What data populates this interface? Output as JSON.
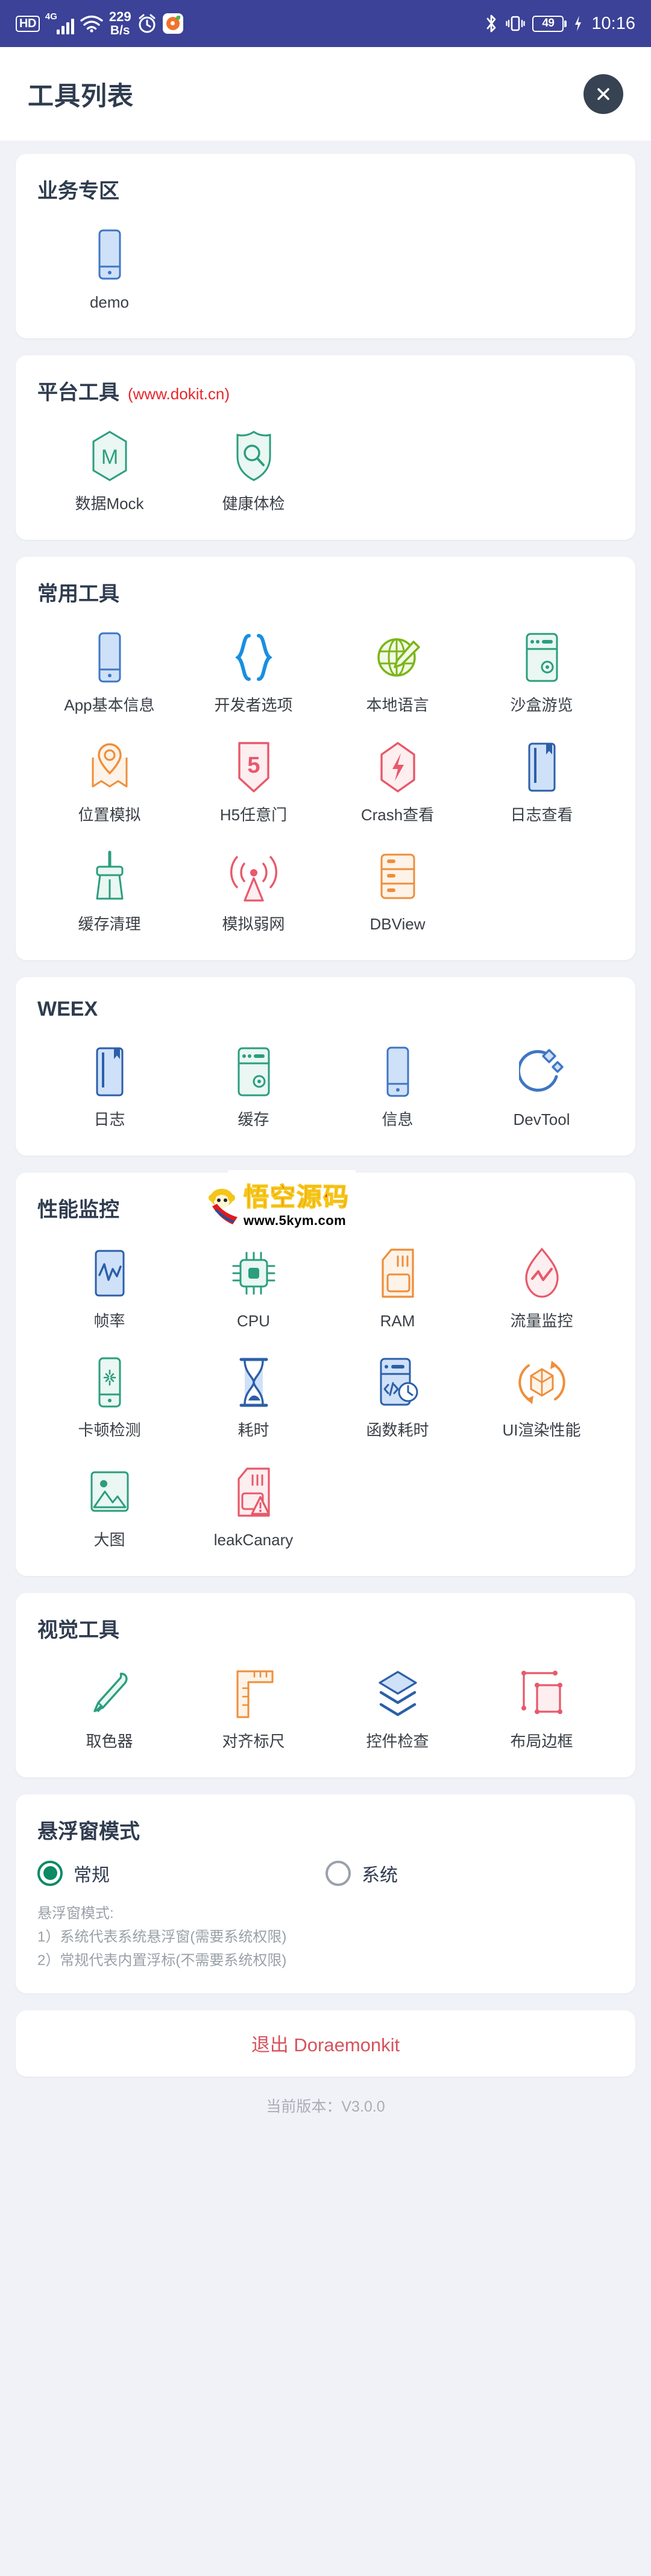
{
  "statusbar": {
    "hd": "HD",
    "network": "4G",
    "speed_value": "229",
    "speed_unit": "B/s",
    "battery": "49",
    "time": "10:16",
    "icons": [
      "hd-icon",
      "signal-4g-icon",
      "wifi-icon",
      "network-speed",
      "alarm-clock-icon",
      "app-badge-icon",
      "bluetooth-icon",
      "vibrate-icon",
      "battery-icon",
      "charging-icon"
    ]
  },
  "appbar": {
    "title": "工具列表",
    "close_label": "×"
  },
  "sections": [
    {
      "id": "business",
      "title": "业务专区",
      "subtitle": "",
      "items": [
        {
          "label": "demo",
          "icon": "phone-icon",
          "color": "#3f76c4"
        }
      ]
    },
    {
      "id": "platform",
      "title": "平台工具",
      "subtitle": "(www.dokit.cn)",
      "items": [
        {
          "label": "数据Mock",
          "icon": "mock-hexagon-icon",
          "color": "#2b9e7e"
        },
        {
          "label": "健康体检",
          "icon": "shield-search-icon",
          "color": "#2b9e7e"
        }
      ]
    },
    {
      "id": "common",
      "title": "常用工具",
      "subtitle": "",
      "items": [
        {
          "label": "App基本信息",
          "icon": "phone-icon",
          "color": "#3f76c4"
        },
        {
          "label": "开发者选项",
          "icon": "braces-icon",
          "color": "#1a8fe0"
        },
        {
          "label": "本地语言",
          "icon": "globe-pen-icon",
          "color": "#7cb518"
        },
        {
          "label": "沙盒游览",
          "icon": "server-icon",
          "color": "#2b9e7e"
        },
        {
          "label": "位置模拟",
          "icon": "map-pin-icon",
          "color": "#ef8e3a"
        },
        {
          "label": "H5任意门",
          "icon": "html5-icon",
          "color": "#e8596a"
        },
        {
          "label": "Crash查看",
          "icon": "crash-bolt-icon",
          "color": "#e8596a"
        },
        {
          "label": "日志查看",
          "icon": "log-book-icon",
          "color": "#3f76c4"
        },
        {
          "label": "缓存清理",
          "icon": "broom-icon",
          "color": "#2b9e7e"
        },
        {
          "label": "模拟弱网",
          "icon": "signal-tower-icon",
          "color": "#e8596a"
        },
        {
          "label": "DBView",
          "icon": "database-icon",
          "color": "#ef8e3a"
        }
      ]
    },
    {
      "id": "weex",
      "title": "WEEX",
      "subtitle": "",
      "items": [
        {
          "label": "日志",
          "icon": "log-book-icon",
          "color": "#3f76c4"
        },
        {
          "label": "缓存",
          "icon": "server-icon",
          "color": "#2b9e7e"
        },
        {
          "label": "信息",
          "icon": "phone-icon",
          "color": "#3f76c4"
        },
        {
          "label": "DevTool",
          "icon": "devtool-icon",
          "color": "#3f76c4"
        }
      ]
    },
    {
      "id": "performance",
      "title": "性能监控",
      "subtitle": "",
      "items": [
        {
          "label": "帧率",
          "icon": "fps-chart-icon",
          "color": "#3f76c4"
        },
        {
          "label": "CPU",
          "icon": "cpu-chip-icon",
          "color": "#2b9e7e"
        },
        {
          "label": "RAM",
          "icon": "ram-card-icon",
          "color": "#ef8e3a"
        },
        {
          "label": "流量监控",
          "icon": "traffic-drop-icon",
          "color": "#e8596a"
        },
        {
          "label": "卡顿检测",
          "icon": "phone-spinner-icon",
          "color": "#2b9e7e"
        },
        {
          "label": "耗时",
          "icon": "hourglass-icon",
          "color": "#3f76c4"
        },
        {
          "label": "函数耗时",
          "icon": "code-clock-icon",
          "color": "#3f76c4"
        },
        {
          "label": "UI渲染性能",
          "icon": "cube-refresh-icon",
          "color": "#ef8e3a"
        },
        {
          "label": "大图",
          "icon": "image-icon",
          "color": "#2b9e7e"
        },
        {
          "label": "leakCanary",
          "icon": "leak-warning-icon",
          "color": "#e8596a"
        }
      ]
    },
    {
      "id": "visual",
      "title": "视觉工具",
      "subtitle": "",
      "items": [
        {
          "label": "取色器",
          "icon": "color-picker-icon",
          "color": "#2b9e7e"
        },
        {
          "label": "对齐标尺",
          "icon": "ruler-icon",
          "color": "#ef8e3a"
        },
        {
          "label": "控件检查",
          "icon": "layers-icon",
          "color": "#3f76c4"
        },
        {
          "label": "布局边框",
          "icon": "layout-border-icon",
          "color": "#e8596a"
        }
      ]
    }
  ],
  "float_mode": {
    "title": "悬浮窗模式",
    "options": [
      {
        "label": "常规",
        "selected": true
      },
      {
        "label": "系统",
        "selected": false
      }
    ],
    "hint_title": "悬浮窗模式:",
    "hint_line1": "1）系统代表系统悬浮窗(需要系统权限)",
    "hint_line2": "2）常规代表内置浮标(不需要系统权限)"
  },
  "exit": {
    "label": "退出 Doraemonkit"
  },
  "footer": {
    "version": "当前版本：V3.0.0"
  },
  "watermark": {
    "cn": "悟空源码",
    "url": "www.5kym.com"
  },
  "colors": {
    "statusbar_bg": "#3b4297",
    "page_bg": "#f0f2f7",
    "card_bg": "#ffffff",
    "title": "#2f3c4f",
    "accent_red": "#e8262b",
    "exit_red": "#d9515b",
    "radio_on": "#0b8a63"
  }
}
